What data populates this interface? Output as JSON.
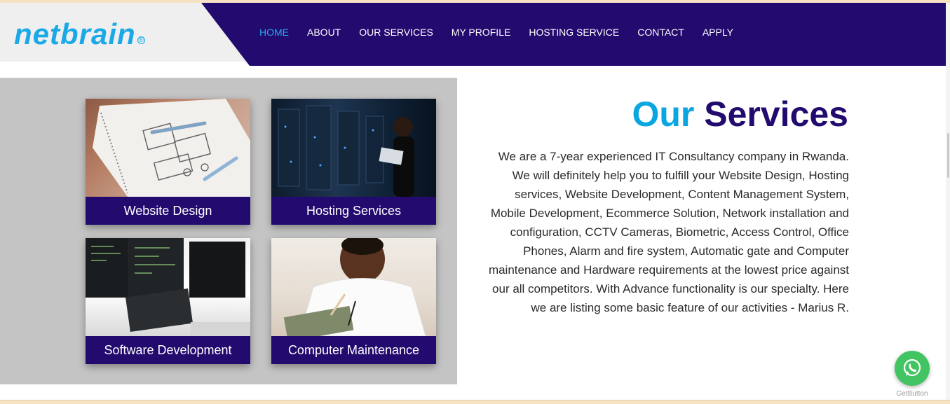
{
  "header": {
    "logo_text": "netbrain",
    "logo_mark": "®",
    "nav": [
      {
        "label": "HOME",
        "active": true
      },
      {
        "label": "ABOUT",
        "active": false
      },
      {
        "label": "OUR SERVICES",
        "active": false
      },
      {
        "label": "MY PROFILE",
        "active": false
      },
      {
        "label": "HOSTING SERVICE",
        "active": false
      },
      {
        "label": "CONTACT",
        "active": false
      },
      {
        "label": "APPLY",
        "active": false
      }
    ]
  },
  "services": {
    "cards": [
      {
        "label": "Website Design",
        "icon": "wireframe-sketch-photo"
      },
      {
        "label": "Hosting Services",
        "icon": "server-room-photo"
      },
      {
        "label": "Software Development",
        "icon": "code-monitors-photo"
      },
      {
        "label": "Computer Maintenance",
        "icon": "circuit-repair-photo"
      }
    ],
    "title_part1": "Our",
    "title_part2": "Services",
    "description": "We are a 7-year experienced IT Consultancy company in Rwanda. We will definitely help you to fulfill your Website Design, Hosting services, Website Development, Content Management System, Mobile Development, Ecommerce Solution, Network installation and configuration, CCTV Cameras, Biometric, Access Control, Office Phones, Alarm and fire system, Automatic gate and Computer maintenance and Hardware requirements at the lowest price against our all competitors. With Advance functionality is our specialty. Here we are listing some basic feature of our activities - Marius R."
  },
  "whatsapp": {
    "icon": "whatsapp-icon",
    "caption": "GetButton"
  },
  "colors": {
    "brand_navy": "#220a6e",
    "brand_blue": "#0aa6e2",
    "whatsapp_green": "#43c463"
  }
}
